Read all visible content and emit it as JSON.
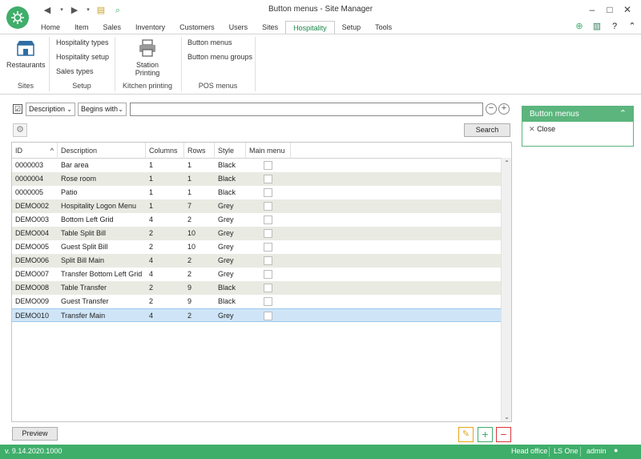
{
  "window": {
    "title": "Button menus - Site Manager",
    "controls": [
      "minimize-icon",
      "maximize-icon",
      "close-icon"
    ]
  },
  "quick_access": [
    "back-icon",
    "dropdown-icon",
    "forward-icon",
    "dropdown-icon",
    "notes-icon",
    "search-icon"
  ],
  "menu_tabs": [
    {
      "label": "Home"
    },
    {
      "label": "Item"
    },
    {
      "label": "Sales"
    },
    {
      "label": "Inventory"
    },
    {
      "label": "Customers"
    },
    {
      "label": "Users"
    },
    {
      "label": "Sites"
    },
    {
      "label": "Hospitality",
      "active": true
    },
    {
      "label": "Setup"
    },
    {
      "label": "Tools"
    }
  ],
  "top_right_icons": [
    "plus-circle-icon",
    "app-icon",
    "help-icon",
    "collapse-icon"
  ],
  "ribbon": {
    "groups": [
      {
        "label": "Sites",
        "items": [
          "Restaurants"
        ]
      },
      {
        "label": "Setup",
        "items": [
          "Hospitality types",
          "Hospitality setup",
          "Sales types"
        ]
      },
      {
        "label": "Kitchen printing",
        "items": [
          "Station Printing"
        ]
      },
      {
        "label": "POS menus",
        "items": [
          "Button menus",
          "Button menu groups"
        ]
      }
    ]
  },
  "filter": {
    "checked": "☑",
    "field": "Description",
    "operator": "Begins with",
    "value": "",
    "search_label": "Search"
  },
  "grid": {
    "columns": [
      "ID",
      "Description",
      "Columns",
      "Rows",
      "Style",
      "Main menu"
    ],
    "sort_indicator": "^",
    "rows": [
      {
        "id": "0000003",
        "description": "Bar area",
        "columns": "1",
        "rows": "1",
        "style": "Black",
        "main_menu": false
      },
      {
        "id": "0000004",
        "description": "Rose room",
        "columns": "1",
        "rows": "1",
        "style": "Black",
        "main_menu": false
      },
      {
        "id": "0000005",
        "description": "Patio",
        "columns": "1",
        "rows": "1",
        "style": "Black",
        "main_menu": false
      },
      {
        "id": "DEMO002",
        "description": "Hospitality Logon Menu",
        "columns": "1",
        "rows": "7",
        "style": "Grey",
        "main_menu": false
      },
      {
        "id": "DEMO003",
        "description": "Bottom Left Grid",
        "columns": "4",
        "rows": "2",
        "style": "Grey",
        "main_menu": false
      },
      {
        "id": "DEMO004",
        "description": "Table Split Bill",
        "columns": "2",
        "rows": "10",
        "style": "Grey",
        "main_menu": false
      },
      {
        "id": "DEMO005",
        "description": "Guest Split Bill",
        "columns": "2",
        "rows": "10",
        "style": "Grey",
        "main_menu": false
      },
      {
        "id": "DEMO006",
        "description": "Split Bill Main",
        "columns": "4",
        "rows": "2",
        "style": "Grey",
        "main_menu": false
      },
      {
        "id": "DEMO007",
        "description": "Transfer Bottom Left Grid",
        "columns": "4",
        "rows": "2",
        "style": "Grey",
        "main_menu": false
      },
      {
        "id": "DEMO008",
        "description": "Table Transfer",
        "columns": "2",
        "rows": "9",
        "style": "Black",
        "main_menu": false
      },
      {
        "id": "DEMO009",
        "description": "Guest Transfer",
        "columns": "2",
        "rows": "9",
        "style": "Black",
        "main_menu": false
      },
      {
        "id": "DEMO010",
        "description": "Transfer Main",
        "columns": "4",
        "rows": "2",
        "style": "Grey",
        "main_menu": false,
        "selected": true
      }
    ]
  },
  "preview_label": "Preview",
  "right_panel": {
    "title": "Button menus",
    "close_label": "Close"
  },
  "status_bar": {
    "version": "v. 9.14.2020.1000",
    "store": "Head office",
    "product": "LS One",
    "user": "admin"
  },
  "colors": {
    "accent": "#3fae6b",
    "panel_header": "#5bb57d",
    "alt_row": "#e9ebe3",
    "selected_row": "#cfe5f7",
    "edit": "#e8a317",
    "add": "#3fae6b",
    "remove": "#d9363e"
  }
}
